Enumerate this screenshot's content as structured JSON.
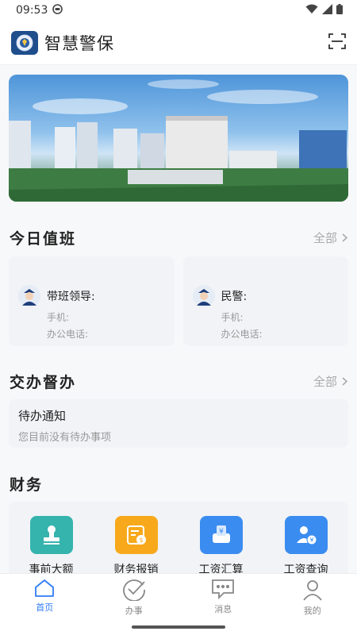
{
  "status_bar": {
    "time": "09:53"
  },
  "header": {
    "title": "智慧警保"
  },
  "duty": {
    "title": "今日值班",
    "more": "全部",
    "cards": [
      {
        "role": "带班领导:",
        "phone_label": "手机:",
        "office_label": "办公电话:"
      },
      {
        "role": "民警:",
        "phone_label": "手机:",
        "office_label": "办公电话:"
      }
    ]
  },
  "tasks": {
    "title": "交办督办",
    "more": "全部",
    "todo_title": "待办通知",
    "todo_sub": "您目前没有待办事项"
  },
  "finance": {
    "title": "财务",
    "items": [
      {
        "label": "事前大额",
        "color": "#35b3ad"
      },
      {
        "label": "财务报销",
        "color": "#f7a91b"
      },
      {
        "label": "工资汇算",
        "color": "#3b8cf0"
      },
      {
        "label": "工资查询",
        "color": "#3b8cf0"
      }
    ]
  },
  "tabs": [
    {
      "label": "首页",
      "icon": "home-icon",
      "active": true
    },
    {
      "label": "办事",
      "icon": "check-circle-icon",
      "active": false
    },
    {
      "label": "消息",
      "icon": "message-icon",
      "active": false
    },
    {
      "label": "我的",
      "icon": "user-icon",
      "active": false
    }
  ],
  "colors": {
    "accent": "#2f7bf6",
    "card_bg": "#f1f3f6"
  }
}
